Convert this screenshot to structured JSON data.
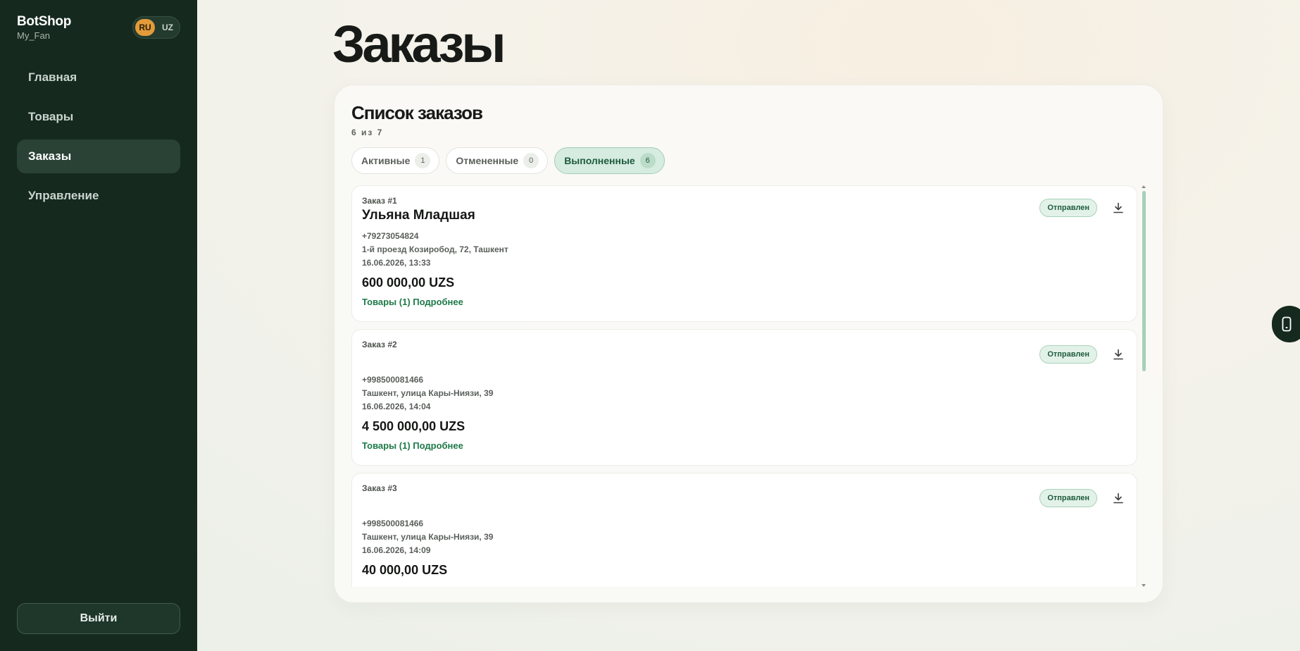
{
  "sidebar": {
    "brand": "BotShop",
    "subtitle": "My_Fan",
    "languages": [
      {
        "code": "RU",
        "active": true
      },
      {
        "code": "UZ",
        "active": false
      }
    ],
    "nav": [
      {
        "label": "Главная",
        "active": false
      },
      {
        "label": "Товары",
        "active": false
      },
      {
        "label": "Заказы",
        "active": true
      },
      {
        "label": "Управление",
        "active": false
      }
    ],
    "logout_label": "Выйти"
  },
  "main": {
    "title": "Заказы",
    "panel": {
      "title": "Список заказов",
      "count": "6 из 7",
      "tabs": [
        {
          "label": "Активные",
          "count": "1",
          "active": false
        },
        {
          "label": "Отмененные",
          "count": "0",
          "active": false
        },
        {
          "label": "Выполненные",
          "count": "6",
          "active": true
        }
      ],
      "orders": [
        {
          "number": "Заказ #1",
          "customer": "Ульяна Младшая",
          "phone": "+79273054824",
          "address": "1-й проезд Козиробод, 72, Ташкент",
          "date": "16.06.2026, 13:33",
          "total": "600 000,00 UZS",
          "link": "Товары (1) Подробнее",
          "status": "Отправлен"
        },
        {
          "number": "Заказ #2",
          "customer": "",
          "phone": "+998500081466",
          "address": "Ташкент, улица Кары-Ниязи, 39",
          "date": "16.06.2026, 14:04",
          "total": "4 500 000,00 UZS",
          "link": "Товары (1) Подробнее",
          "status": "Отправлен"
        },
        {
          "number": "Заказ #3",
          "customer": "",
          "phone": "+998500081466",
          "address": "Ташкент, улица Кары-Ниязи, 39",
          "date": "16.06.2026, 14:09",
          "total": "40 000,00 UZS",
          "link": "",
          "status": "Отправлен"
        }
      ]
    }
  },
  "icons": {
    "download": "download-icon",
    "mobile": "mobile-icon"
  },
  "colors": {
    "sidebar_bg": "#15291f",
    "accent_green": "#1e7a48",
    "lang_active": "#e39b3a"
  }
}
